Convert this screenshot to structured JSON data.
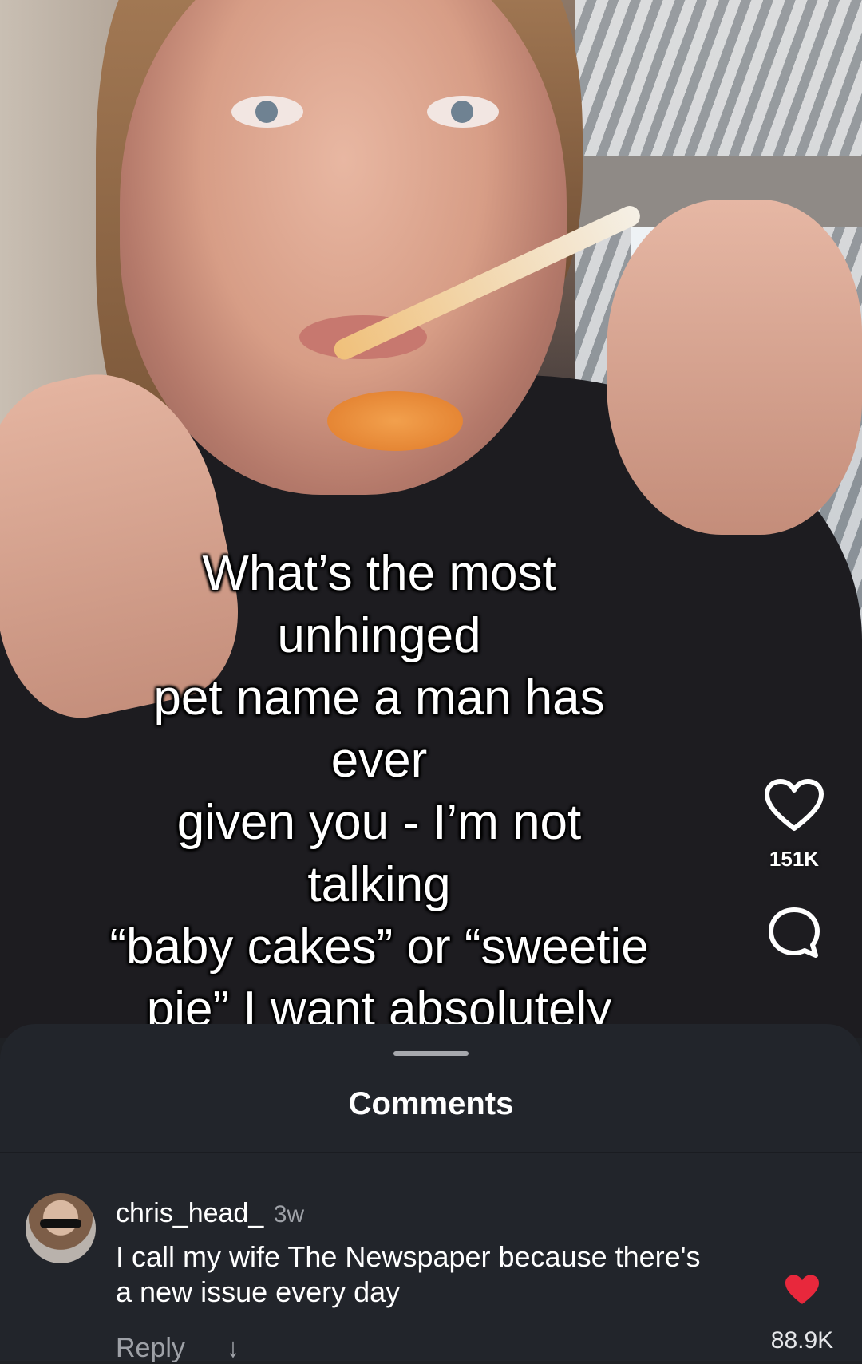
{
  "video": {
    "caption": "What’s the most unhinged\npet name a man has ever\ngiven you - I’m not talking\n“baby cakes” or “sweetie\npie” I want absolutely\nunhinged ideas for my\nboyfriend",
    "likes": "151K"
  },
  "sheet": {
    "title": "Comments"
  },
  "comments": [
    {
      "username": "chris_head_",
      "time": "3w",
      "text": "I call my wife The Newspaper because there's a new issue every day",
      "reply_label": "Reply",
      "reply_arrow": "↓",
      "like_count": "88.9K",
      "liked": true
    }
  ],
  "colors": {
    "sheet_bg": "#22252b",
    "liked_heart": "#e8283c",
    "muted_text": "#9ea1a7"
  },
  "icons": [
    "heart-outline-icon",
    "comment-bubble-icon",
    "heart-filled-icon",
    "down-arrow-icon"
  ]
}
